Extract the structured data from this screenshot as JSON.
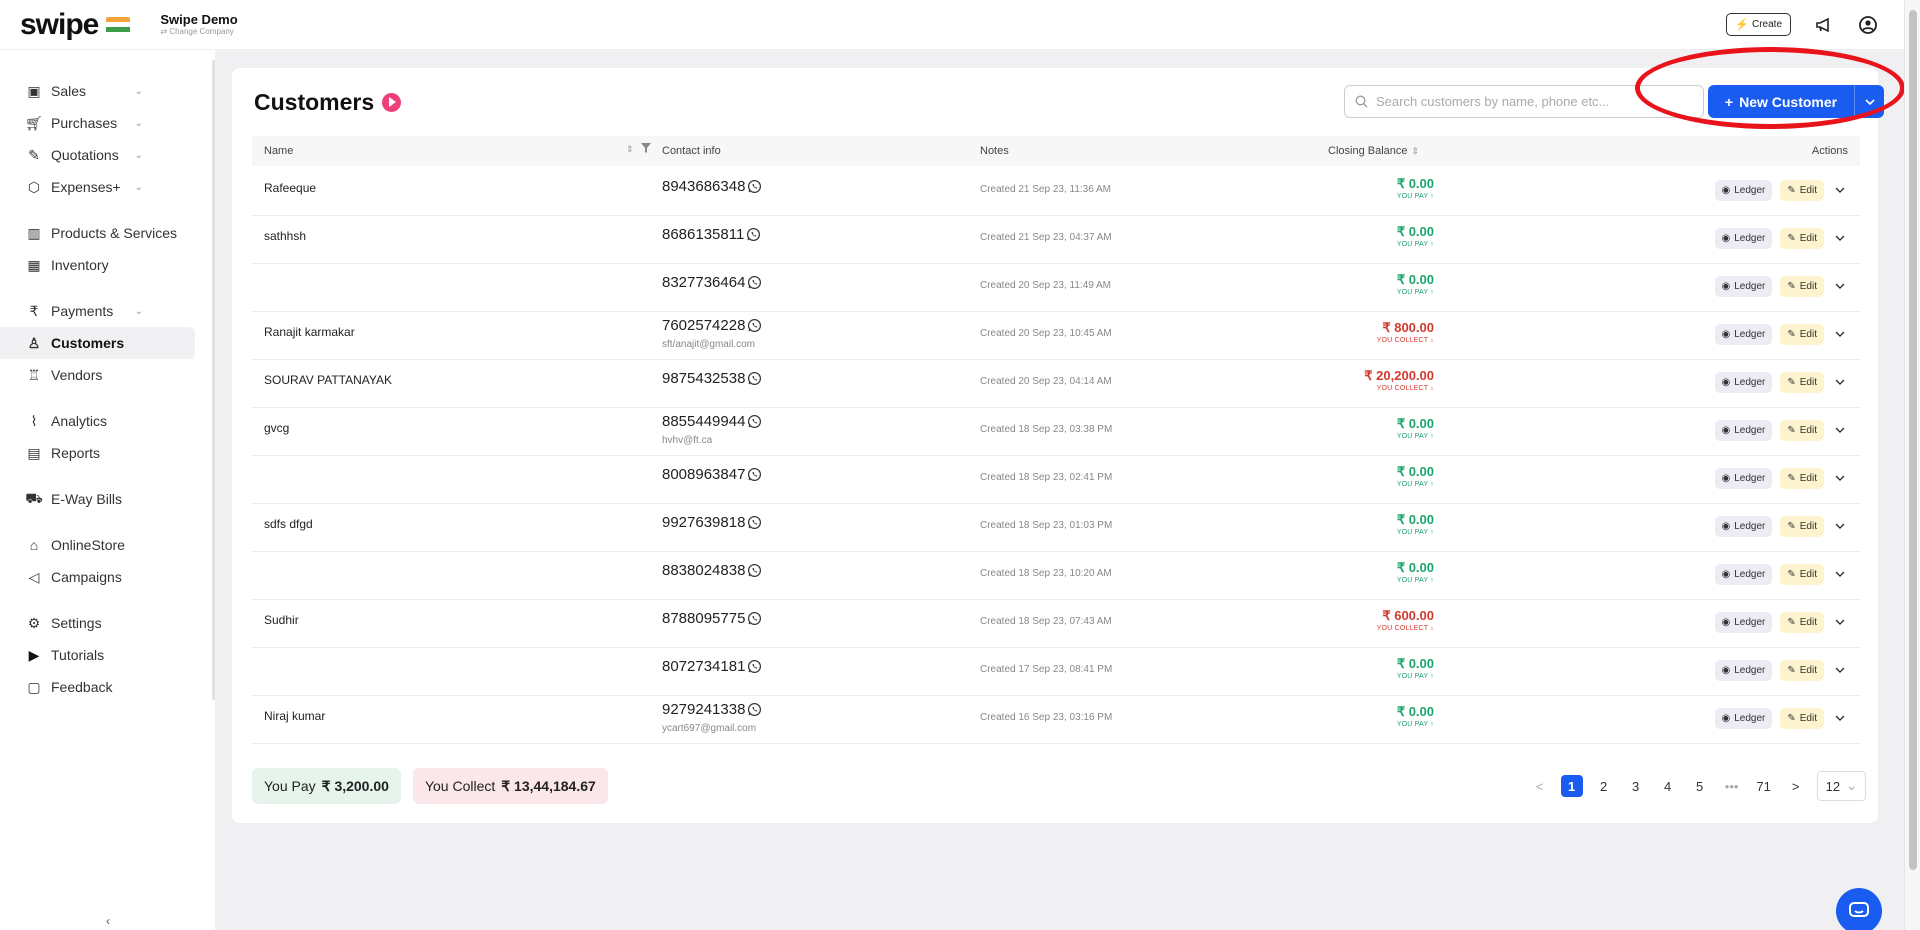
{
  "brand": {
    "logo_text": "swipe",
    "company_name": "Swipe Demo",
    "change_company": "⇄ Change Company"
  },
  "topbar": {
    "create_label": "Create",
    "create_icon": "⚡"
  },
  "sidebar": {
    "groups": [
      [
        {
          "label": "Sales",
          "icon": "sales-icon",
          "chevron": true
        },
        {
          "label": "Purchases",
          "icon": "cart-icon",
          "chevron": true
        },
        {
          "label": "Quotations",
          "icon": "pen-icon",
          "chevron": true
        },
        {
          "label": "Expenses+",
          "icon": "tag-icon",
          "chevron": true
        }
      ],
      [
        {
          "label": "Products & Services",
          "icon": "barcode-icon"
        },
        {
          "label": "Inventory",
          "icon": "warehouse-icon"
        }
      ],
      [
        {
          "label": "Payments",
          "icon": "rupee-icon",
          "chevron": true
        },
        {
          "label": "Customers",
          "icon": "user-icon",
          "active": true
        },
        {
          "label": "Vendors",
          "icon": "users-icon"
        }
      ],
      [
        {
          "label": "Analytics",
          "icon": "chart-icon"
        },
        {
          "label": "Reports",
          "icon": "report-icon"
        }
      ],
      [
        {
          "label": "E-Way Bills",
          "icon": "truck-icon"
        }
      ],
      [
        {
          "label": "OnlineStore",
          "icon": "store-icon"
        },
        {
          "label": "Campaigns",
          "icon": "megaphone-icon"
        }
      ],
      [
        {
          "label": "Settings",
          "icon": "gear-icon"
        },
        {
          "label": "Tutorials",
          "icon": "youtube-icon"
        },
        {
          "label": "Feedback",
          "icon": "feedback-icon"
        }
      ]
    ]
  },
  "main": {
    "title": "Customers",
    "search_placeholder": "Search customers by name, phone etc...",
    "new_customer_label": "New Customer",
    "columns": {
      "name": "Name",
      "contact": "Contact info",
      "notes": "Notes",
      "balance": "Closing Balance",
      "actions": "Actions"
    },
    "ledger_label": "Ledger",
    "edit_label": "Edit",
    "rows": [
      {
        "name": "Rafeeque",
        "phone": "8943686348",
        "email": "",
        "notes": "Created 21 Sep 23, 11:36 AM",
        "amount": "₹ 0.00",
        "sub": "YOU PAY",
        "type": "pay"
      },
      {
        "name": "sathhsh",
        "phone": "8686135811",
        "email": "",
        "notes": "Created 21 Sep 23, 04:37 AM",
        "amount": "₹ 0.00",
        "sub": "YOU PAY",
        "type": "pay"
      },
      {
        "name": "",
        "phone": "8327736464",
        "email": "",
        "notes": "Created 20 Sep 23, 11:49 AM",
        "amount": "₹ 0.00",
        "sub": "YOU PAY",
        "type": "pay"
      },
      {
        "name": "Ranajit karmakar",
        "phone": "7602574228",
        "email": "sft/anajit@gmail.com",
        "notes": "Created 20 Sep 23, 10:45 AM",
        "amount": "₹ 800.00",
        "sub": "YOU COLLECT",
        "type": "collect"
      },
      {
        "name": "SOURAV PATTANAYAK",
        "phone": "9875432538",
        "email": "",
        "notes": "Created 20 Sep 23, 04:14 AM",
        "amount": "₹ 20,200.00",
        "sub": "YOU COLLECT",
        "type": "collect"
      },
      {
        "name": "gvcg",
        "phone": "8855449944",
        "email": "hvhv@ft.ca",
        "notes": "Created 18 Sep 23, 03:38 PM",
        "amount": "₹ 0.00",
        "sub": "YOU PAY",
        "type": "pay"
      },
      {
        "name": "",
        "phone": "8008963847",
        "email": "",
        "notes": "Created 18 Sep 23, 02:41 PM",
        "amount": "₹ 0.00",
        "sub": "YOU PAY",
        "type": "pay"
      },
      {
        "name": "sdfs dfgd",
        "phone": "9927639818",
        "email": "",
        "notes": "Created 18 Sep 23, 01:03 PM",
        "amount": "₹ 0.00",
        "sub": "YOU PAY",
        "type": "pay"
      },
      {
        "name": "",
        "phone": "8838024838",
        "email": "",
        "notes": "Created 18 Sep 23, 10:20 AM",
        "amount": "₹ 0.00",
        "sub": "YOU PAY",
        "type": "pay"
      },
      {
        "name": "Sudhir",
        "phone": "8788095775",
        "email": "",
        "notes": "Created 18 Sep 23, 07:43 AM",
        "amount": "₹ 600.00",
        "sub": "YOU COLLECT",
        "type": "collect"
      },
      {
        "name": "",
        "phone": "8072734181",
        "email": "",
        "notes": "Created 17 Sep 23, 08:41 PM",
        "amount": "₹ 0.00",
        "sub": "YOU PAY",
        "type": "pay"
      },
      {
        "name": "Niraj kumar",
        "phone": "9279241338",
        "email": "ycart697@gmail.com",
        "notes": "Created 16 Sep 23, 03:16 PM",
        "amount": "₹ 0.00",
        "sub": "YOU PAY",
        "type": "pay"
      }
    ],
    "summary": {
      "pay_label": "You Pay",
      "pay_value": "₹ 3,200.00",
      "collect_label": "You Collect",
      "collect_value": "₹ 13,44,184.67"
    },
    "pagination": {
      "prev": "<",
      "pages": [
        "1",
        "2",
        "3",
        "4",
        "5"
      ],
      "ellipsis": "•••",
      "last": "71",
      "next": ">",
      "page_size": "12"
    }
  },
  "colors": {
    "accent": "#1a5cf0",
    "pay": "#1aa56b",
    "collect": "#d33a2e",
    "annotation_ring": "#e8131b"
  }
}
